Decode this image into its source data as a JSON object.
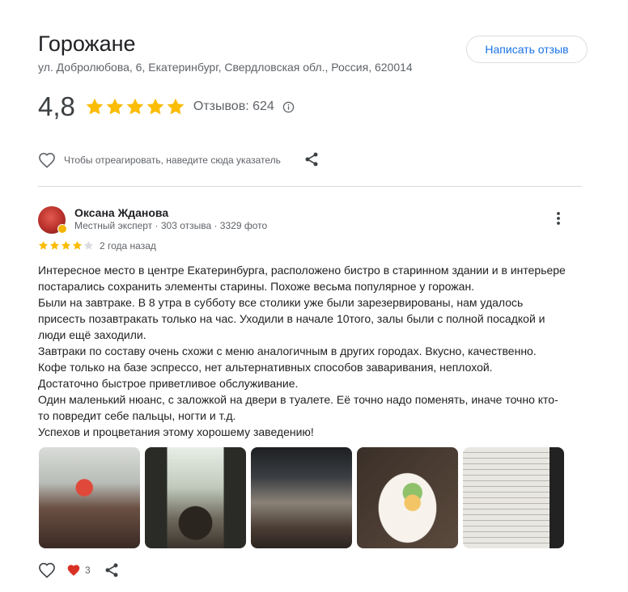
{
  "place": {
    "title": "Горожане",
    "address": "ул. Добролюбова, 6, Екатеринбург, Свердловская обл., Россия, 620014",
    "write_review_label": "Написать отзыв",
    "rating": "4,8",
    "stars_filled": 5,
    "reviews_label": "Отзывов: 624",
    "react_hint": "Чтобы отреагировать, наведите сюда указатель"
  },
  "review": {
    "author": "Оксана Жданова",
    "meta": "Местный эксперт · 303 отзыва · 3329 фото",
    "stars_filled": 4,
    "date": "2 года назад",
    "text_lines": [
      "Интересное место в центре Екатеринбурга, расположено бистро в старинном здании и в интерьере",
      "постарались сохранить элементы старины. Похоже весьма популярное у горожан.",
      "Были на завтраке. В 8 утра в субботу все столики уже были зарезервированы, нам удалось",
      "присесть позавтракать только на час. Уходили в начале 10того, залы были с полной посадкой и",
      "люди ещё заходили.",
      "Завтраки по составу очень схожи с меню аналогичным в других городах. Вкусно, качественно.",
      "Кофе только на базе эспрессо, нет альтернативных способов заваривания, неплохой.",
      "Достаточно быстрое приветливое обслуживание.",
      "Один маленький нюанс, с заложкой на двери в туалете. Её точно надо поменять, иначе точно кто-",
      "то повредит себе пальцы, ногти и т.д.",
      "Успехов и процветания этому хорошему заведению!"
    ],
    "likes": "3"
  },
  "colors": {
    "star": "#fbbc04",
    "star_empty": "#dadce0",
    "accent": "#1a73e8",
    "like_heart": "#d93025"
  }
}
